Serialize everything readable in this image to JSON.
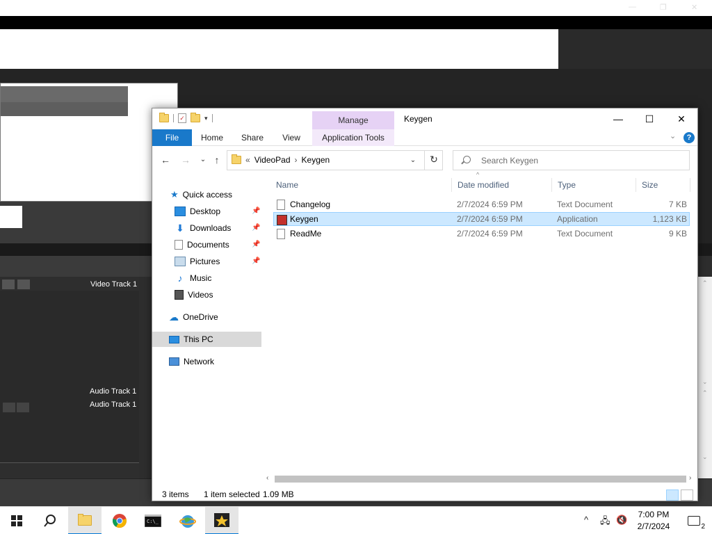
{
  "explorer": {
    "window_title": "Keygen",
    "qat_down": "▾",
    "manage_tab": "Manage",
    "controls": {
      "minimize": "—",
      "maximize": "☐",
      "close": "✕"
    },
    "ribbon": {
      "file": "File",
      "home": "Home",
      "share": "Share",
      "view": "View",
      "app_tools": "Application Tools",
      "expand": "⌄",
      "help": "?"
    },
    "nav": {
      "back": "←",
      "forward": "→",
      "recent": "⌄",
      "up": "↑",
      "refresh": "↻",
      "drop": "⌄"
    },
    "address": {
      "chevrons": "«",
      "segments": [
        "VideoPad",
        "Keygen"
      ],
      "sep": "›"
    },
    "search_placeholder": "Search Keygen",
    "nav_pane": {
      "quick_access": "Quick access",
      "items": [
        "Desktop",
        "Downloads",
        "Documents",
        "Pictures",
        "Music",
        "Videos"
      ],
      "onedrive": "OneDrive",
      "this_pc": "This PC",
      "network": "Network"
    },
    "columns": [
      "Name",
      "Date modified",
      "Type",
      "Size"
    ],
    "files": [
      {
        "name": "Changelog",
        "date": "2/7/2024 6:59 PM",
        "type": "Text Document",
        "size": "7 KB"
      },
      {
        "name": "Keygen",
        "date": "2/7/2024 6:59 PM",
        "type": "Application",
        "size": "1,123 KB"
      },
      {
        "name": "ReadMe",
        "date": "2/7/2024 6:59 PM",
        "type": "Text Document",
        "size": "9 KB"
      }
    ],
    "status": {
      "items": "3 items",
      "selected": "1 item selected",
      "size": "1.09 MB"
    },
    "scroll": {
      "left": "‹",
      "right": "›"
    }
  },
  "background_app": {
    "video_track": "Video Track 1",
    "audio_track_1": "Audio Track 1",
    "audio_track_2": "Audio Track 1"
  },
  "taskbar": {
    "time": "7:00 PM",
    "date": "2/7/2024",
    "notifications": "2",
    "tray_up": "^"
  }
}
